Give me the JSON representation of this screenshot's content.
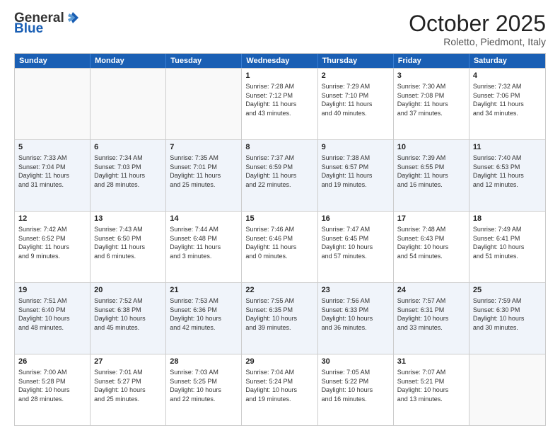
{
  "logo": {
    "general": "General",
    "blue": "Blue"
  },
  "header": {
    "month": "October 2025",
    "location": "Roletto, Piedmont, Italy"
  },
  "weekdays": [
    "Sunday",
    "Monday",
    "Tuesday",
    "Wednesday",
    "Thursday",
    "Friday",
    "Saturday"
  ],
  "rows": [
    {
      "cells": [
        {
          "day": "",
          "text": "",
          "empty": true
        },
        {
          "day": "",
          "text": "",
          "empty": true
        },
        {
          "day": "",
          "text": "",
          "empty": true
        },
        {
          "day": "1",
          "text": "Sunrise: 7:28 AM\nSunset: 7:12 PM\nDaylight: 11 hours\nand 43 minutes."
        },
        {
          "day": "2",
          "text": "Sunrise: 7:29 AM\nSunset: 7:10 PM\nDaylight: 11 hours\nand 40 minutes."
        },
        {
          "day": "3",
          "text": "Sunrise: 7:30 AM\nSunset: 7:08 PM\nDaylight: 11 hours\nand 37 minutes."
        },
        {
          "day": "4",
          "text": "Sunrise: 7:32 AM\nSunset: 7:06 PM\nDaylight: 11 hours\nand 34 minutes."
        }
      ]
    },
    {
      "cells": [
        {
          "day": "5",
          "text": "Sunrise: 7:33 AM\nSunset: 7:04 PM\nDaylight: 11 hours\nand 31 minutes."
        },
        {
          "day": "6",
          "text": "Sunrise: 7:34 AM\nSunset: 7:03 PM\nDaylight: 11 hours\nand 28 minutes."
        },
        {
          "day": "7",
          "text": "Sunrise: 7:35 AM\nSunset: 7:01 PM\nDaylight: 11 hours\nand 25 minutes."
        },
        {
          "day": "8",
          "text": "Sunrise: 7:37 AM\nSunset: 6:59 PM\nDaylight: 11 hours\nand 22 minutes."
        },
        {
          "day": "9",
          "text": "Sunrise: 7:38 AM\nSunset: 6:57 PM\nDaylight: 11 hours\nand 19 minutes."
        },
        {
          "day": "10",
          "text": "Sunrise: 7:39 AM\nSunset: 6:55 PM\nDaylight: 11 hours\nand 16 minutes."
        },
        {
          "day": "11",
          "text": "Sunrise: 7:40 AM\nSunset: 6:53 PM\nDaylight: 11 hours\nand 12 minutes."
        }
      ]
    },
    {
      "cells": [
        {
          "day": "12",
          "text": "Sunrise: 7:42 AM\nSunset: 6:52 PM\nDaylight: 11 hours\nand 9 minutes."
        },
        {
          "day": "13",
          "text": "Sunrise: 7:43 AM\nSunset: 6:50 PM\nDaylight: 11 hours\nand 6 minutes."
        },
        {
          "day": "14",
          "text": "Sunrise: 7:44 AM\nSunset: 6:48 PM\nDaylight: 11 hours\nand 3 minutes."
        },
        {
          "day": "15",
          "text": "Sunrise: 7:46 AM\nSunset: 6:46 PM\nDaylight: 11 hours\nand 0 minutes."
        },
        {
          "day": "16",
          "text": "Sunrise: 7:47 AM\nSunset: 6:45 PM\nDaylight: 10 hours\nand 57 minutes."
        },
        {
          "day": "17",
          "text": "Sunrise: 7:48 AM\nSunset: 6:43 PM\nDaylight: 10 hours\nand 54 minutes."
        },
        {
          "day": "18",
          "text": "Sunrise: 7:49 AM\nSunset: 6:41 PM\nDaylight: 10 hours\nand 51 minutes."
        }
      ]
    },
    {
      "cells": [
        {
          "day": "19",
          "text": "Sunrise: 7:51 AM\nSunset: 6:40 PM\nDaylight: 10 hours\nand 48 minutes."
        },
        {
          "day": "20",
          "text": "Sunrise: 7:52 AM\nSunset: 6:38 PM\nDaylight: 10 hours\nand 45 minutes."
        },
        {
          "day": "21",
          "text": "Sunrise: 7:53 AM\nSunset: 6:36 PM\nDaylight: 10 hours\nand 42 minutes."
        },
        {
          "day": "22",
          "text": "Sunrise: 7:55 AM\nSunset: 6:35 PM\nDaylight: 10 hours\nand 39 minutes."
        },
        {
          "day": "23",
          "text": "Sunrise: 7:56 AM\nSunset: 6:33 PM\nDaylight: 10 hours\nand 36 minutes."
        },
        {
          "day": "24",
          "text": "Sunrise: 7:57 AM\nSunset: 6:31 PM\nDaylight: 10 hours\nand 33 minutes."
        },
        {
          "day": "25",
          "text": "Sunrise: 7:59 AM\nSunset: 6:30 PM\nDaylight: 10 hours\nand 30 minutes."
        }
      ]
    },
    {
      "cells": [
        {
          "day": "26",
          "text": "Sunrise: 7:00 AM\nSunset: 5:28 PM\nDaylight: 10 hours\nand 28 minutes."
        },
        {
          "day": "27",
          "text": "Sunrise: 7:01 AM\nSunset: 5:27 PM\nDaylight: 10 hours\nand 25 minutes."
        },
        {
          "day": "28",
          "text": "Sunrise: 7:03 AM\nSunset: 5:25 PM\nDaylight: 10 hours\nand 22 minutes."
        },
        {
          "day": "29",
          "text": "Sunrise: 7:04 AM\nSunset: 5:24 PM\nDaylight: 10 hours\nand 19 minutes."
        },
        {
          "day": "30",
          "text": "Sunrise: 7:05 AM\nSunset: 5:22 PM\nDaylight: 10 hours\nand 16 minutes."
        },
        {
          "day": "31",
          "text": "Sunrise: 7:07 AM\nSunset: 5:21 PM\nDaylight: 10 hours\nand 13 minutes."
        },
        {
          "day": "",
          "text": "",
          "empty": true
        }
      ]
    }
  ]
}
